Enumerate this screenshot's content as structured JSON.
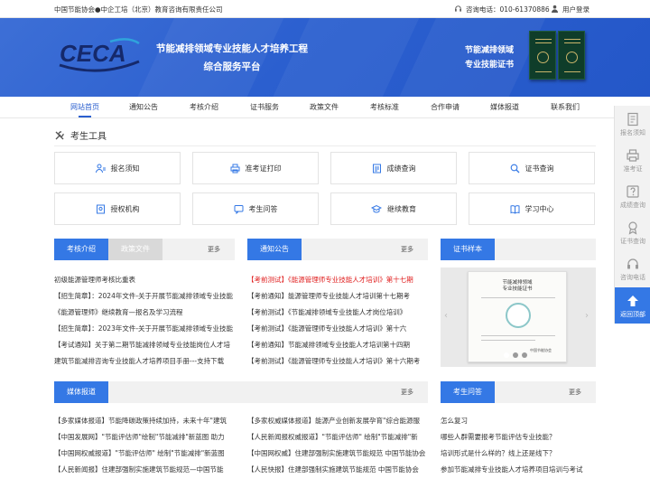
{
  "topbar": {
    "org": "中国节能协会●中企工培（北京）教育咨询有限责任公司",
    "tel": "咨询电话：010-61370886",
    "login": "用户登录"
  },
  "banner": {
    "logo_text": "CECA",
    "title_line1": "节能减排领域专业技能人才培养工程",
    "title_line2": "综合服务平台",
    "cert_line1": "节能减排领域",
    "cert_line2": "专业技能证书"
  },
  "nav": [
    "网站首页",
    "通知公告",
    "考核介绍",
    "证书服务",
    "政策文件",
    "考核标准",
    "合作申请",
    "媒体报道",
    "联系我们"
  ],
  "tools_title": "考生工具",
  "tools": [
    "报名须知",
    "准考证打印",
    "成绩查询",
    "证书查询",
    "授权机构",
    "考生问答",
    "继续教育",
    "学习中心"
  ],
  "more": "更多",
  "panel1": {
    "tab_active": "考核介绍",
    "tab_inactive": "政策文件",
    "items": [
      "初级能源管理师考核比重表",
      "【招生简章】：2024年文件-关于开展节能减排领域专业技能",
      "《能源管理师》继续教育—报名及学习流程",
      "【招生简章】：2023年文件-关于开展节能减排领域专业技能",
      "【考试通知】关于第二期节能减排领域专业技能岗位人才培",
      "建筑节能减排咨询专业技能人才培养项目手册---支持下载"
    ]
  },
  "panel2": {
    "tab": "通知公告",
    "items": [
      {
        "prefix": "【考前测试】",
        "text": "《能源管理师专业技能人才培训》第十七期",
        "red": true
      },
      {
        "prefix": "【考前通知】",
        "text": "能源管理师专业技能人才培训第十七期考",
        "red": false
      },
      {
        "prefix": "【考前测试】",
        "text": "《节能减排领域专业技能人才岗位培训》",
        "red": false
      },
      {
        "prefix": "【考前测试】",
        "text": "《能源管理师专业技能人才培训》第十六",
        "red": false
      },
      {
        "prefix": "【考前通知】",
        "text": "节能减排领域专业技能人才培训第十四期",
        "red": false
      },
      {
        "prefix": "【考前测试】",
        "text": "《能源管理师专业技能人才培训》第十六期考",
        "red": false
      }
    ]
  },
  "panel3": {
    "tab": "证书样本",
    "cert_title_1": "节能减排领域",
    "cert_title_2": "专业技能证书",
    "cert_footer": "中国节能协会"
  },
  "panel4": {
    "tab": "媒体报道",
    "items": [
      "【多家媒体报道】节能降碳政策持续加持，未来十年\"建筑",
      "【中国发展网】\"节能评估师\"绘制\"节能减排\"新蓝图 助力",
      "【中国网权威报道】\"节能评估师\" 绘制\"节能减排\"新蓝图",
      "【人民新闻报】住建部强制实施建筑节能规范—中国节能"
    ]
  },
  "panel5": {
    "items": [
      "【多家权威媒体报道】能源产业创新发展孕育\"综合能源服",
      "【人民新闻报权威报道】\"节能评估师\" 绘制\"节能减排\"新",
      "【中国网权威】住建部强制实施建筑节能规范 中国节能协会",
      "【人民快报】住建部强制实施建筑节能规范 中国节能协会"
    ]
  },
  "panel6": {
    "tab": "考生问答",
    "items": [
      "怎么复习",
      "哪些人群需要报考节能评估专业技能？",
      "培训形式是什么样的？线上还是线下？",
      "参加节能减排专业技能人才培养项目培训与考试"
    ]
  },
  "rail": [
    "报名须知",
    "准考证",
    "成绩查询",
    "证书查询",
    "咨询电话",
    "返回顶部"
  ],
  "colors": {
    "brand": "#2b5fcf",
    "tab": "#3478e5",
    "alert": "#e02020"
  }
}
